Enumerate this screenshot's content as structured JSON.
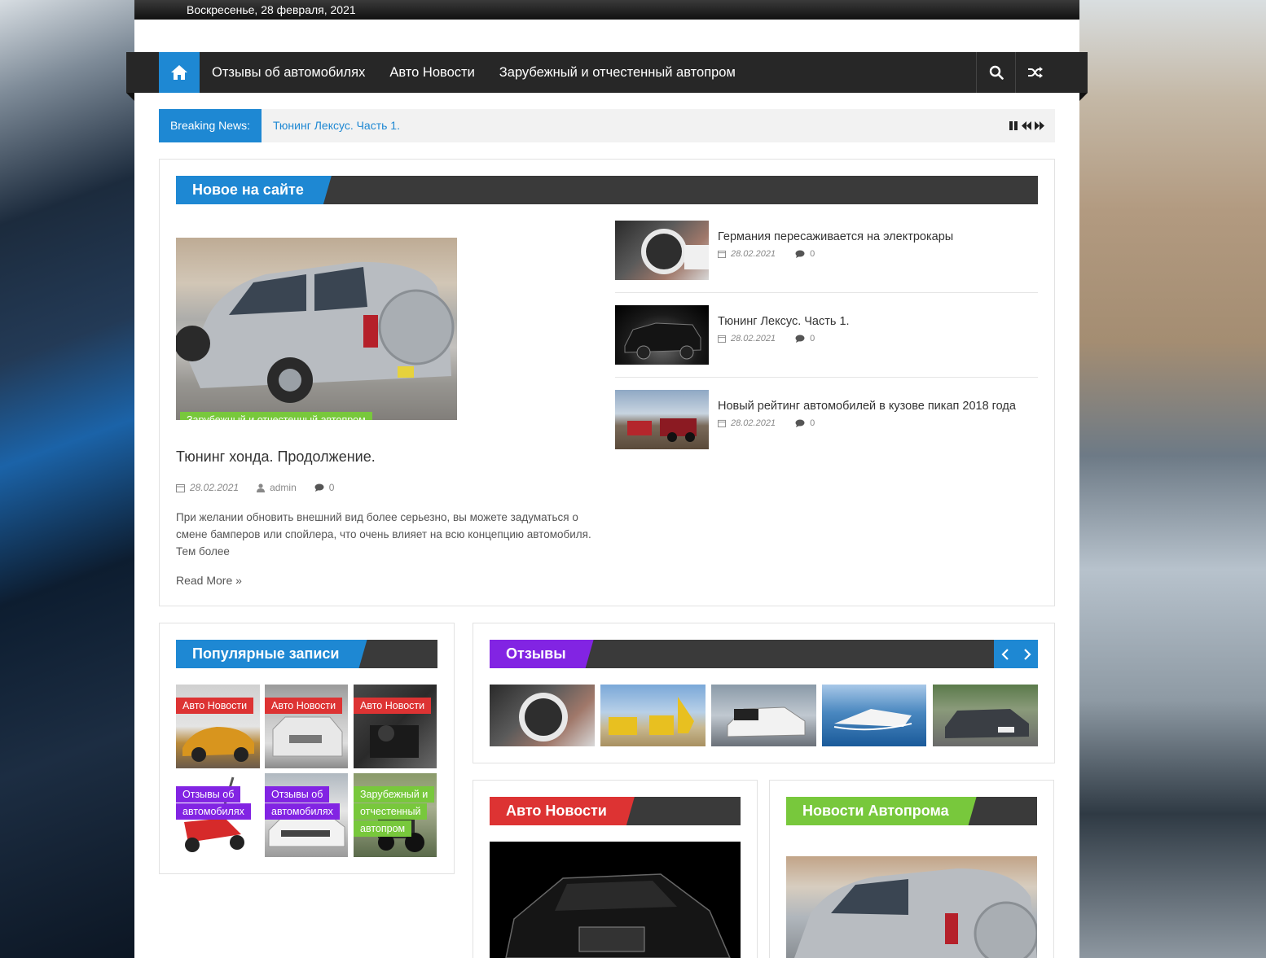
{
  "topbar": {
    "date": "Воскресенье, 28 февраля, 2021"
  },
  "nav": {
    "items": [
      "Отзывы об автомобилях",
      "Авто Новости",
      "Зарубежный и отчестенный автопром"
    ]
  },
  "breaking": {
    "label": "Breaking News:",
    "headline": "Тюнинг Лексус. Часть 1."
  },
  "featured": {
    "section_title": "Новое на сайте",
    "main": {
      "category": "Зарубежный и отчестенный автопром",
      "title": "Тюнинг хонда. Продолжение.",
      "date": "28.02.2021",
      "author": "admin",
      "comments": "0",
      "excerpt": "При желании обновить внешний вид более серьезно, вы можете задуматься о смене бамперов или спойлера, что очень влияет на всю концепцию автомобиля. Тем более",
      "read_more": "Read More »"
    },
    "side": [
      {
        "title": "Германия пересаживается на электрокары",
        "date": "28.02.2021",
        "comments": "0"
      },
      {
        "title": "Тюнинг Лексус. Часть 1.",
        "date": "28.02.2021",
        "comments": "0"
      },
      {
        "title": "Новый рейтинг автомобилей в кузове пикап 2018 года",
        "date": "28.02.2021",
        "comments": "0"
      }
    ]
  },
  "popular": {
    "section_title": "Популярные записи",
    "items": [
      {
        "category": "Авто Новости"
      },
      {
        "category": "Авто Новости"
      },
      {
        "category": "Авто Новости"
      },
      {
        "category_line1": "Отзывы об",
        "category_line2": "автомобилях"
      },
      {
        "category_line1": "Отзывы об",
        "category_line2": "автомобилях"
      },
      {
        "category_line1": "Зарубежный и",
        "category_line2": "отчестенный",
        "category_line3": "автопром"
      }
    ]
  },
  "reviews": {
    "section_title": "Отзывы"
  },
  "auto_news": {
    "section_title": "Авто Новости"
  },
  "industry_news": {
    "section_title": "Новости Автопрома"
  },
  "colors": {
    "accent_blue": "#1e88d3",
    "cat_green": "#78c83c",
    "cat_red": "#dd3333",
    "cat_purple": "#8224e3",
    "dark_bar": "#3a3a3a"
  }
}
